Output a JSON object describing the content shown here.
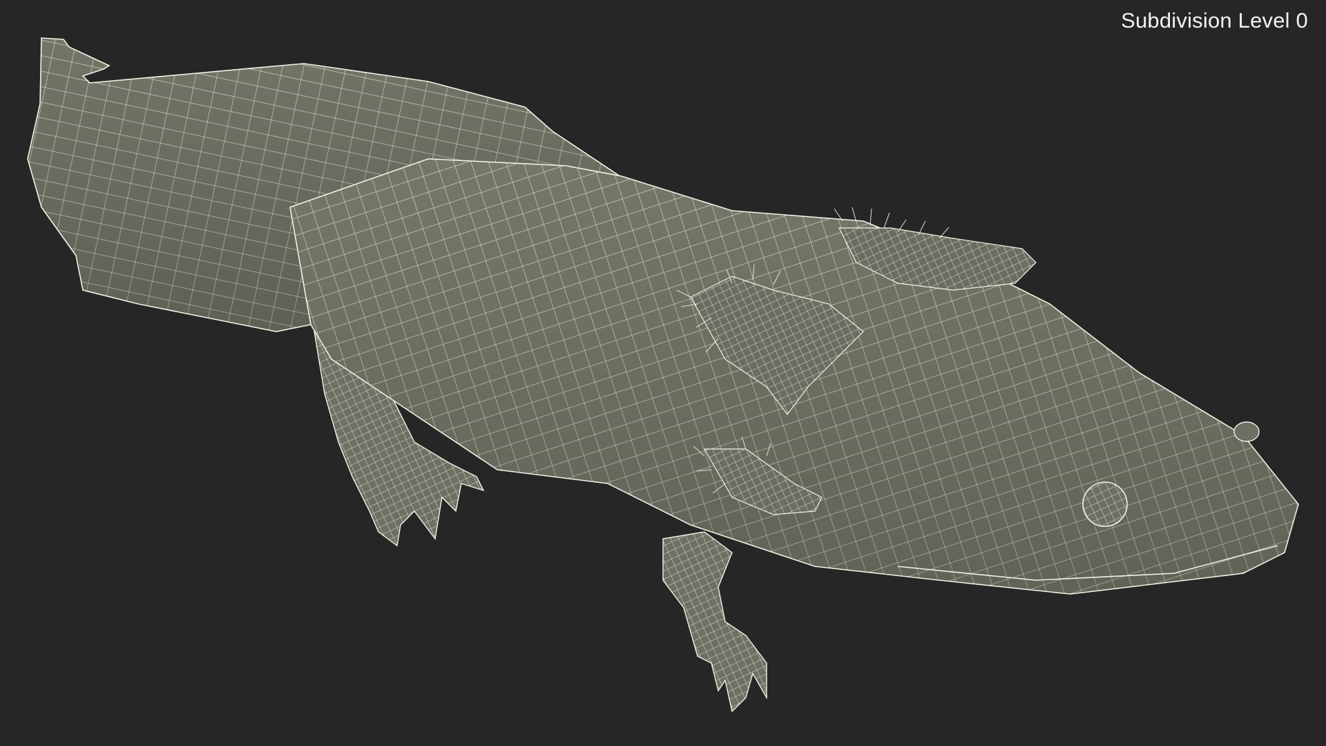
{
  "viewport": {
    "background_color": "#262626",
    "subdivision_label": "Subdivision Level 0"
  },
  "model": {
    "subject": "axolotl",
    "display_mode": "wireframe",
    "surface_color": "#747467",
    "wire_color": "#f2f2e6"
  }
}
